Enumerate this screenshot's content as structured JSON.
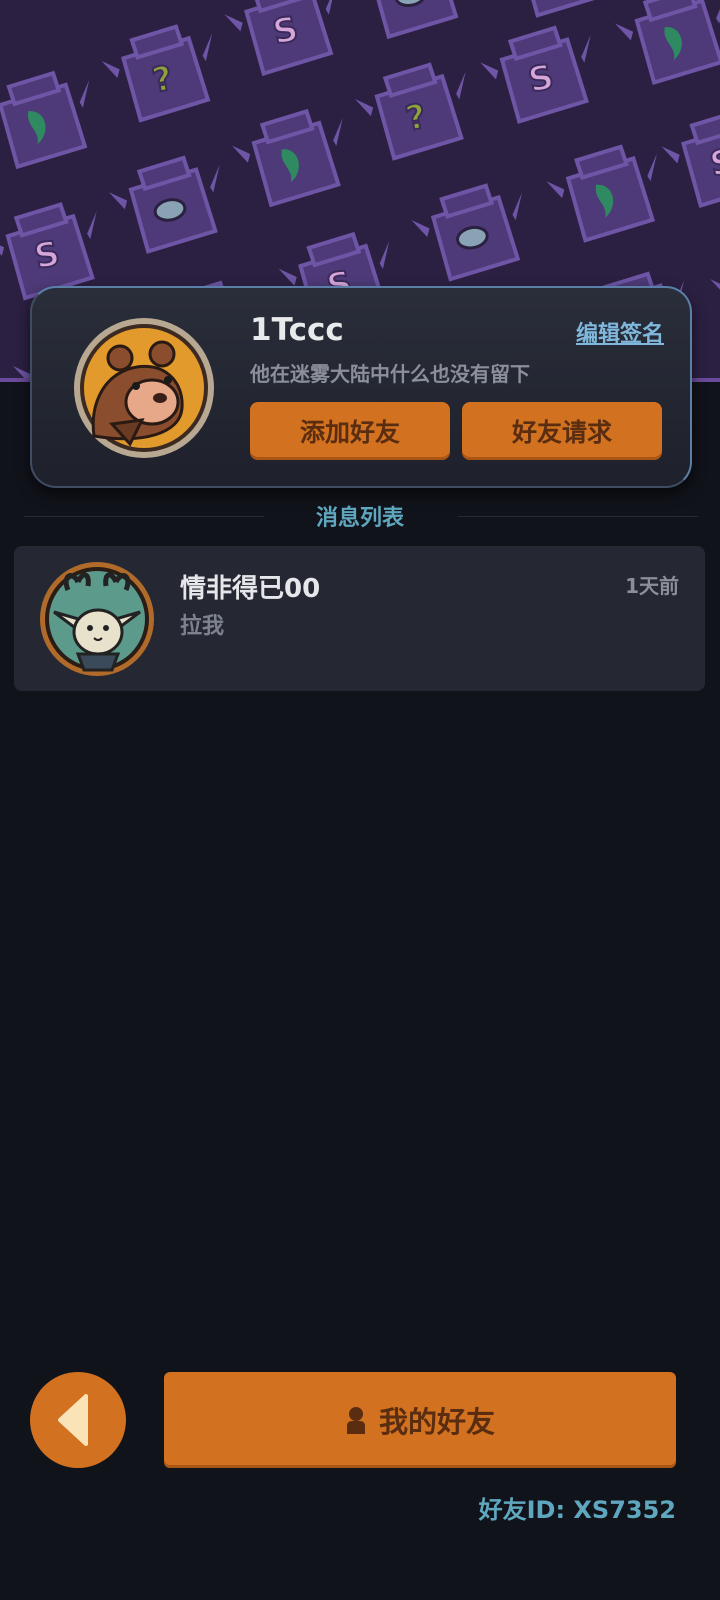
{
  "profile": {
    "username": "1Tccc",
    "edit_signature_label": "编辑签名",
    "signature": "他在迷雾大陆中什么也没有留下",
    "add_friend_label": "添加好友",
    "friend_requests_label": "好友请求",
    "avatar_icon": "bear-avatar-icon"
  },
  "messages": {
    "section_title": "消息列表",
    "items": [
      {
        "name": "情非得已00",
        "preview": "拉我",
        "time": "1天前",
        "avatar_icon": "antlered-creature-avatar-icon"
      }
    ]
  },
  "footer": {
    "my_friends_label": "我的好友",
    "friend_id": "好友ID: XS7352",
    "back_icon": "back-arrow-icon",
    "person_icon": "person-icon"
  },
  "colors": {
    "accent_orange": "#d2711f",
    "accent_text_dark": "#5a2d11",
    "teal_text": "#5fa6bf",
    "link_blue": "#7fb7dd",
    "background": "#11131b",
    "banner_purple": "#2c2042"
  }
}
